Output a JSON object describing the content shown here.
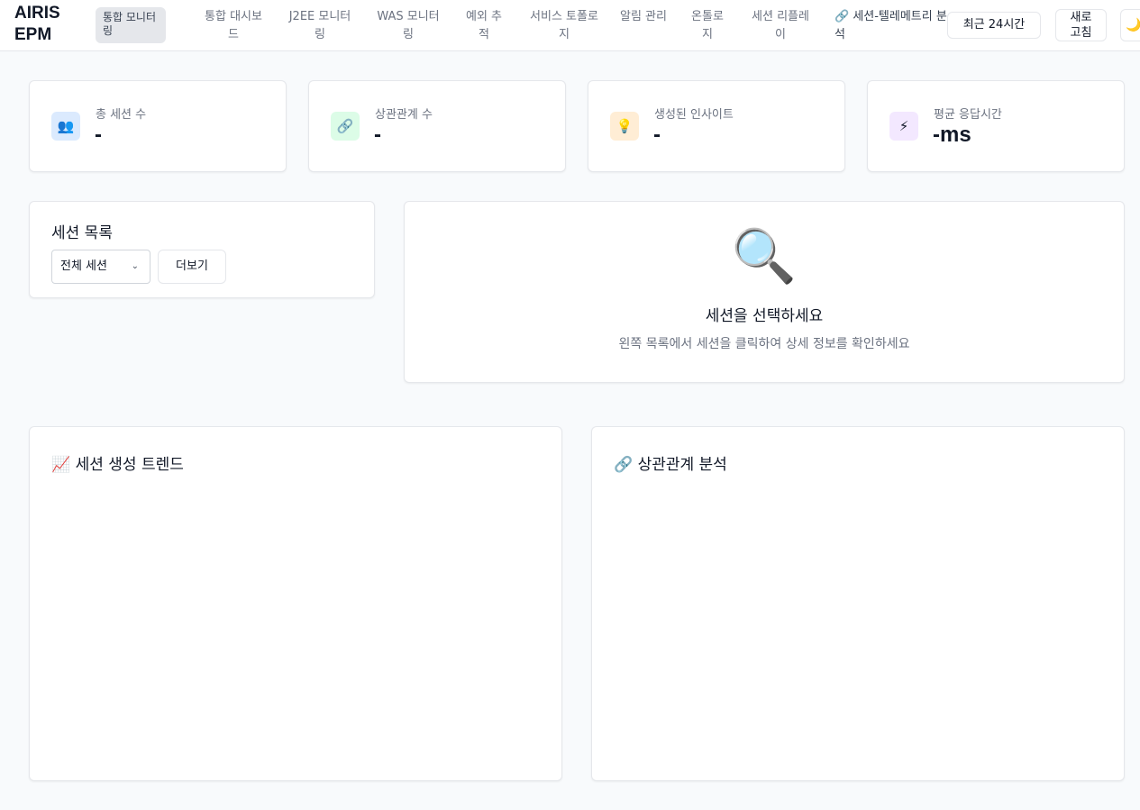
{
  "header": {
    "logo": "AIRIS EPM",
    "badge": "통합 모니터링",
    "nav": [
      {
        "label": "통합 대시보드"
      },
      {
        "label": "J2EE 모니터링"
      },
      {
        "label": "WAS 모니터링"
      },
      {
        "label": "예외 추적"
      },
      {
        "label": "서비스 토폴로지"
      },
      {
        "label": "알림 관리"
      },
      {
        "label": "온톨로지"
      },
      {
        "label": "세션 리플레이"
      },
      {
        "label": "🔗 세션-텔레메트리 분석"
      }
    ],
    "range_button": "최근 24시간",
    "refresh_button": "새로 고침",
    "theme_icon": "🌙"
  },
  "stats": [
    {
      "label": "총 세션 수",
      "value": "-",
      "icon": "👥",
      "icon_name": "users-icon",
      "bg": "#dbeafe"
    },
    {
      "label": "상관관계 수",
      "value": "-",
      "icon": "🔗",
      "icon_name": "link-icon",
      "bg": "#dcfce7"
    },
    {
      "label": "생성된 인사이트",
      "value": "-",
      "icon": "💡",
      "icon_name": "lightbulb-icon",
      "bg": "#ffedd5"
    },
    {
      "label": "평균 응답시간",
      "value": "-ms",
      "icon": "⚡",
      "icon_name": "lightning-icon",
      "bg": "#f3e8ff"
    }
  ],
  "session_list": {
    "title": "세션 목록",
    "filter_value": "전체 세션",
    "more_button": "더보기"
  },
  "detail": {
    "icon": "🔍",
    "title": "세션을 선택하세요",
    "subtitle": "왼쪽 목록에서 세션을 클릭하여 상세 정보를 확인하세요"
  },
  "charts": {
    "trend_title": "📈 세션 생성 트렌드",
    "correlation_title": "🔗 상관관계 분석"
  }
}
